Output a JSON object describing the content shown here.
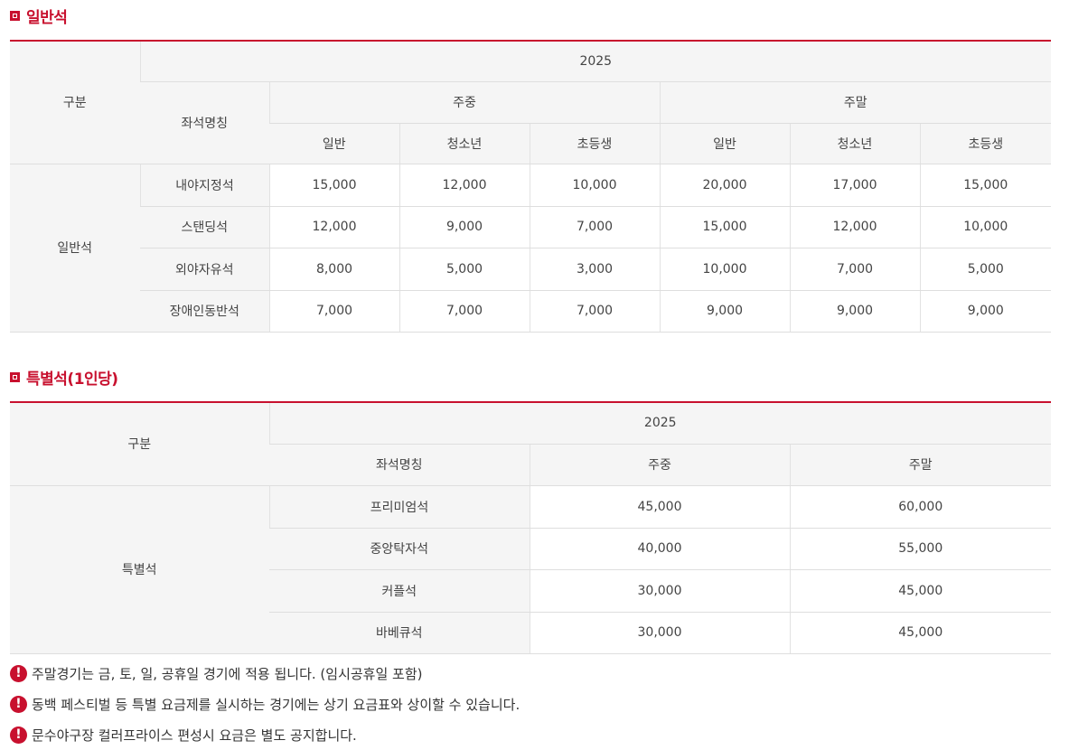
{
  "general": {
    "title": "일반석",
    "header": {
      "category": "구분",
      "year": "2025",
      "seat_name": "좌석명칭",
      "weekday": "주중",
      "weekend": "주말",
      "sub": [
        "일반",
        "청소년",
        "초등생",
        "일반",
        "청소년",
        "초등생"
      ]
    },
    "group_label": "일반석",
    "rows": [
      {
        "name": "내야지정석",
        "prices": [
          "15,000",
          "12,000",
          "10,000",
          "20,000",
          "17,000",
          "15,000"
        ]
      },
      {
        "name": "스탠딩석",
        "prices": [
          "12,000",
          "9,000",
          "7,000",
          "15,000",
          "12,000",
          "10,000"
        ]
      },
      {
        "name": "외야자유석",
        "prices": [
          "8,000",
          "5,000",
          "3,000",
          "10,000",
          "7,000",
          "5,000"
        ]
      },
      {
        "name": "장애인동반석",
        "prices": [
          "7,000",
          "7,000",
          "7,000",
          "9,000",
          "9,000",
          "9,000"
        ]
      }
    ]
  },
  "special": {
    "title": "특별석(1인당)",
    "header": {
      "category": "구분",
      "year": "2025",
      "seat_name": "좌석명칭",
      "weekday": "주중",
      "weekend": "주말"
    },
    "group_label": "특별석",
    "rows": [
      {
        "name": "프리미엄석",
        "prices": [
          "45,000",
          "60,000"
        ]
      },
      {
        "name": "중앙탁자석",
        "prices": [
          "40,000",
          "55,000"
        ]
      },
      {
        "name": "커플석",
        "prices": [
          "30,000",
          "45,000"
        ]
      },
      {
        "name": "바베큐석",
        "prices": [
          "30,000",
          "45,000"
        ]
      }
    ]
  },
  "notes": [
    "주말경기는 금, 토, 일, 공휴일 경기에 적용 됩니다. (임시공휴일 포함)",
    "동백 페스티벌 등 특별 요금제를 실시하는 경기에는 상기 요금표와 상이할 수 있습니다.",
    "문수야구장 컬러프라이스 편성시 요금은 별도 공지합니다."
  ],
  "icons": {
    "section_bullet": "square-bullet-icon",
    "note_icon": "exclamation-circle-icon"
  },
  "colors": {
    "accent": "#c8102e",
    "header_bg": "#f5f5f5"
  }
}
